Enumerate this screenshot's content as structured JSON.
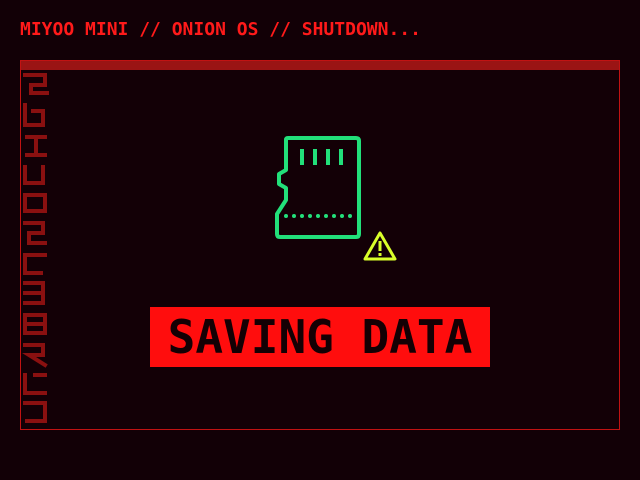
{
  "header": {
    "status_text": "MIYOO MINI // ONION OS // SHUTDOWN..."
  },
  "main": {
    "banner_text": "SAVING DATA"
  },
  "icons": {
    "storage": "sd-card-icon",
    "alert": "warning-icon",
    "side": "cyberpunk-glyph-strip"
  },
  "colors": {
    "accent_red": "#ff0d0d",
    "frame_red": "#c11212",
    "icon_green": "#22e07a",
    "warning_yellow": "#d9ff2a",
    "background": "#120006"
  }
}
